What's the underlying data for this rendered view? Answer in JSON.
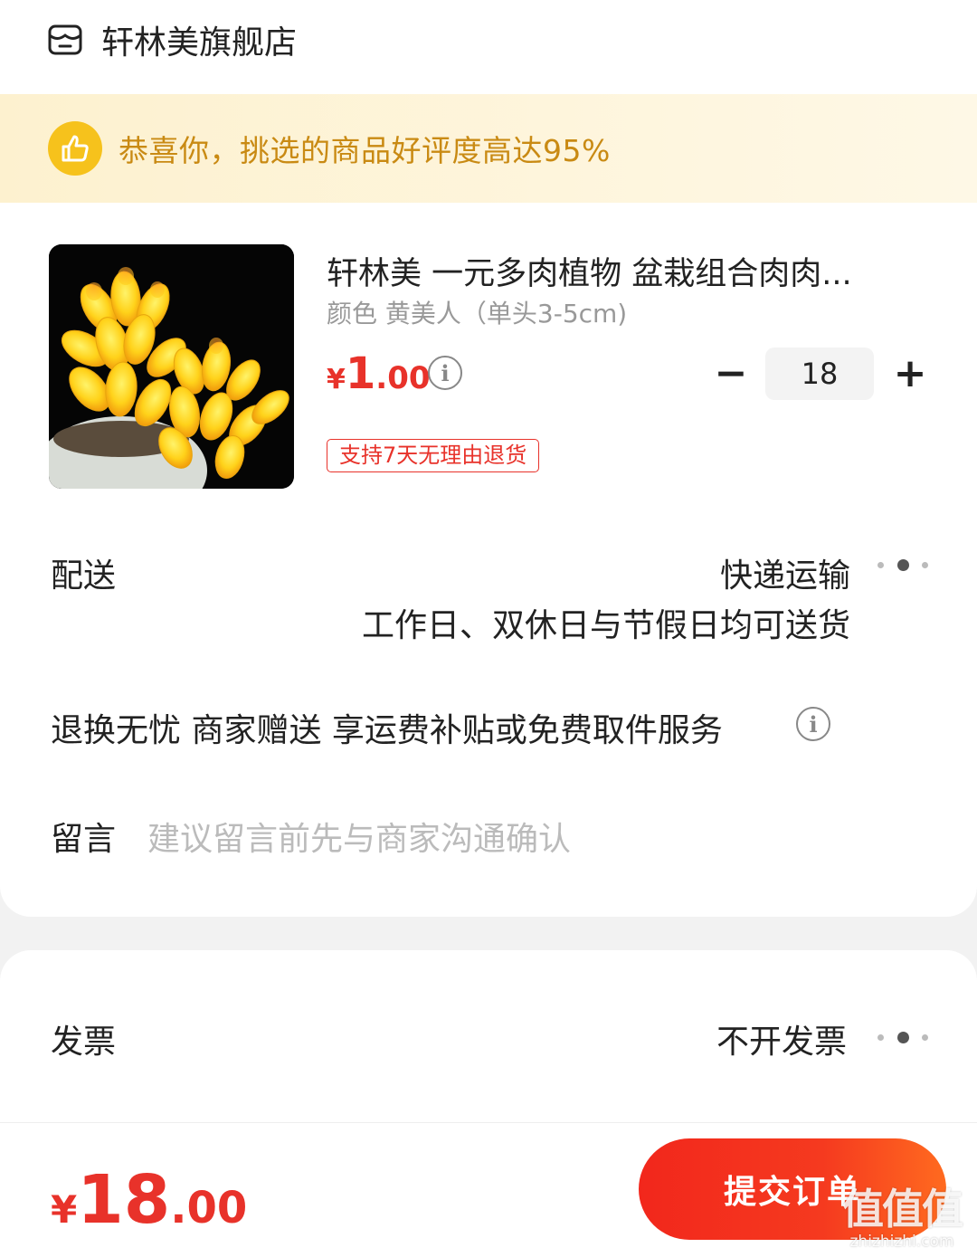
{
  "store": {
    "name": "轩林美旗舰店",
    "icon": "store-icon"
  },
  "banner": {
    "text": "恭喜你，挑选的商品好评度高达95%",
    "icon": "thumbs-up-icon"
  },
  "product": {
    "title": "轩林美 一元多肉植物 盆栽组合肉肉...",
    "spec": "颜色 黄美人（单头3-5cm)",
    "price_currency": "¥",
    "price_int": "1",
    "price_dec": ".00",
    "quantity": "18",
    "minus": "−",
    "plus": "+",
    "return_tag": "支持7天无理由退货"
  },
  "delivery": {
    "label": "配送",
    "method": "快递运输",
    "note": "工作日、双休日与节假日均可送货"
  },
  "returns": {
    "text": "退换无忧 商家赠送  享运费补贴或免费取件服务"
  },
  "message": {
    "label": "留言",
    "placeholder": "建议留言前先与商家沟通确认"
  },
  "invoice": {
    "label": "发票",
    "value": "不开发票"
  },
  "footer": {
    "total_currency": "¥",
    "total_int": "18",
    "total_dec": ".00",
    "submit_label": "提交订单"
  },
  "watermark": {
    "big": "值值值",
    "small": "zhizhizhi.com"
  },
  "colors": {
    "accent": "#e8322a",
    "banner_text": "#c98a13",
    "banner_bg": "#fdf1cf",
    "placeholder": "#bbbbbb"
  }
}
